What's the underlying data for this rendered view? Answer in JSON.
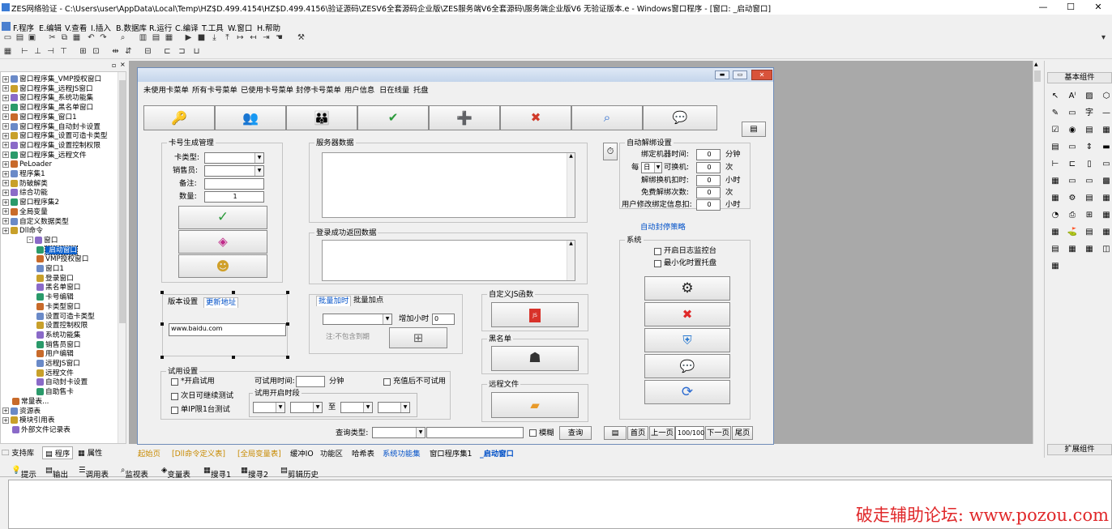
{
  "window": {
    "title": "ZES网络验证 - C:\\Users\\user\\AppData\\Local\\Temp\\HZ$D.499.4154\\HZ$D.499.4156\\验证源码\\ZESV6全套源码企业版\\ZES服务端V6全套源码\\服务端企业版V6  无验证版本.e - Windows窗口程序 - [窗口: _启动窗口]",
    "minimize": "—",
    "maximize": "☐",
    "close": "✕"
  },
  "menu": [
    "F.程序",
    "E.编辑",
    "V.查看",
    "I.插入",
    "B.数据库",
    "R.运行",
    "C.编译",
    "T.工具",
    "W.窗口",
    "H.帮助"
  ],
  "tree": [
    "窗口程序集_VMP授权窗口",
    "窗口程序集_远程JS窗口",
    "窗口程序集_系统功能集",
    "窗口程序集_黑名单窗口",
    "窗口程序集_窗口1",
    "窗口程序集_自动封卡设置",
    "窗口程序集_设置可造卡类型",
    "窗口程序集_设置控制权限",
    "窗口程序集_远程文件",
    "PeLoader",
    "程序集1",
    "防破解类",
    "综合功能",
    "窗口程序集2",
    "全局变量",
    "自定义数据类型",
    "Dll命令",
    "窗口",
    "_启动窗口",
    "VMP授权窗口",
    "窗口1",
    "登录窗口",
    "黑名单窗口",
    "卡号编辑",
    "卡类型窗口",
    "设置可造卡类型",
    "设置控制权限",
    "系统功能集",
    "销售员窗口",
    "用户编辑",
    "远程JS窗口",
    "远程文件",
    "自动封卡设置",
    "自助售卡",
    "常量表...",
    "资源表",
    "模块引用表",
    "外部文件记录表"
  ],
  "tree_tabs": [
    "支持库",
    "程序",
    "属性"
  ],
  "form": {
    "menus": [
      "未使用卡菜单",
      "所有卡号菜单",
      "已使用卡号菜单",
      "封停卡号菜单",
      "用户信息",
      "日在线量",
      "托盘"
    ],
    "card_gen": {
      "title": "卡号生成管理",
      "type_label": "卡类型:",
      "seller_label": "销售员:",
      "note_label": "备注:",
      "qty_label": "数量:",
      "qty": "1"
    },
    "server_data": "服务器数据",
    "login_return": "登录成功返回数据",
    "tabs": {
      "version": "版本设置",
      "update": "更新地址",
      "url": "www.baidu.com"
    },
    "batch": {
      "tab1": "批量加时",
      "tab2": "批量加点",
      "hours_label": "增加小时",
      "hours": "0",
      "note": "注:不包含到期"
    },
    "custom_js": "自定义JS函数",
    "blacklist": "黑名单",
    "remote_file": "远程文件",
    "trial": {
      "title": "试用设置",
      "open": "*开启试用",
      "usable_time": "可试用时间:",
      "minutes": "分钟",
      "no_after_recharge": "充值后不可试用",
      "next_day": "次日可继续测试",
      "period": "试用开启时段",
      "to": "至",
      "single_ip": "单IP限1台测试"
    },
    "unbind": {
      "title": "自动解绑设置",
      "bind_time": "绑定机器时间:",
      "bind_val": "0",
      "minute": "分钟",
      "every": "每",
      "day": "日",
      "can_change": "可换机:",
      "change_val": "0",
      "times": "次",
      "deduct_label": "解绑换机扣时:",
      "deduct_val": "0",
      "hour": "小时",
      "free_label": "免费解绑次数:",
      "free_val": "0",
      "times2": "次",
      "modify_label": "用户修改绑定信息扣:",
      "modify_val": "0",
      "hour2": "小时"
    },
    "auto_ban": "自动封停策略",
    "system": {
      "title": "系统",
      "log": "开启日志监控台",
      "tray": "最小化时置托盘"
    },
    "query": {
      "label": "查询类型:",
      "fuzzy": "模糊",
      "btn": "查询"
    },
    "pager": {
      "first": "首页",
      "prev": "上一页",
      "page": "100/100",
      "next": "下一页",
      "last": "尾页"
    }
  },
  "right_panel": {
    "title": "基本组件",
    "footer": "扩展组件"
  },
  "file_tabs": [
    "起始页",
    "[Dll命令定义表]",
    "[全局变量表]",
    "缓冲IO",
    "功能区",
    "哈希表",
    "系统功能集",
    "窗口程序集1",
    "_启动窗口"
  ],
  "output_tabs": [
    "提示",
    "输出",
    "调用表",
    "监视表",
    "变量表",
    "搜寻1",
    "搜寻2",
    "剪辑历史"
  ],
  "watermark": "破走辅助论坛: www.pozou.com"
}
